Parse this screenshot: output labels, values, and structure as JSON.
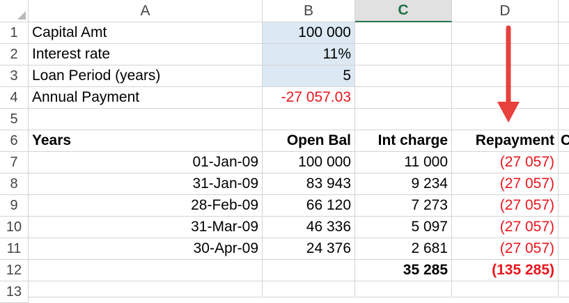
{
  "columns": [
    "A",
    "B",
    "C",
    "D"
  ],
  "rows": [
    "1",
    "2",
    "3",
    "4",
    "5",
    "6",
    "7",
    "8",
    "9",
    "10",
    "11",
    "12",
    "13"
  ],
  "inputs": {
    "capital": {
      "label": "Capital Amt",
      "value": "100 000"
    },
    "rate": {
      "label": "Interest rate",
      "value": "11%"
    },
    "period": {
      "label": "Loan Period (years)",
      "value": "5"
    },
    "payment": {
      "label": "Annual Payment",
      "value": "-27 057.03"
    }
  },
  "table": {
    "headers": {
      "years": "Years",
      "open_bal": "Open Bal",
      "int_charge": "Int charge",
      "repayment": "Repayment",
      "next": "C"
    },
    "rows": [
      {
        "date": "01-Jan-09",
        "open": "100 000",
        "int": "11 000",
        "repay": "(27 057)"
      },
      {
        "date": "31-Jan-09",
        "open": "83 943",
        "int": "9 234",
        "repay": "(27 057)"
      },
      {
        "date": "28-Feb-09",
        "open": "66 120",
        "int": "7 273",
        "repay": "(27 057)"
      },
      {
        "date": "31-Mar-09",
        "open": "46 336",
        "int": "5 097",
        "repay": "(27 057)"
      },
      {
        "date": "30-Apr-09",
        "open": "24 376",
        "int": "2 681",
        "repay": "(27 057)"
      }
    ],
    "totals": {
      "int": "35 285",
      "repay": "(135 285)"
    }
  },
  "colors": {
    "accent": "#217346",
    "negative": "#e8161d",
    "input_fill": "#dce9f5",
    "arrow": "#e8403c"
  }
}
